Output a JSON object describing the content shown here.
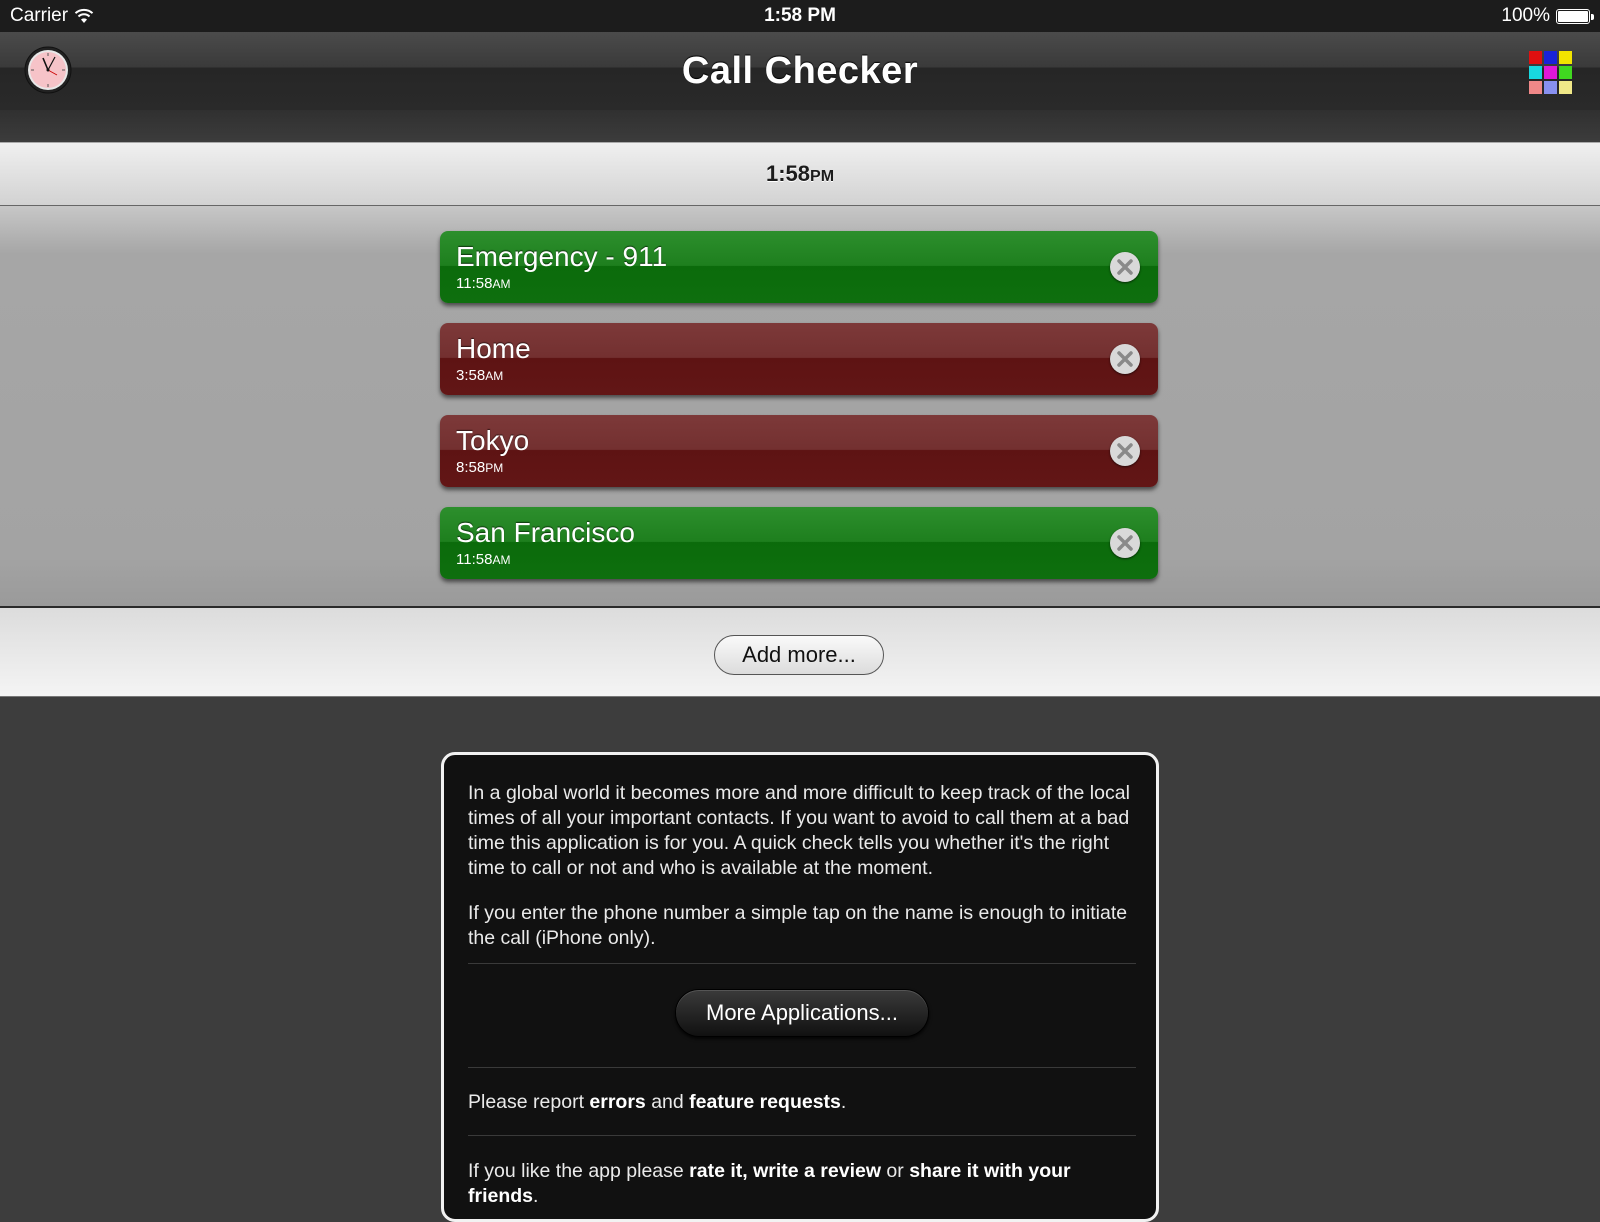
{
  "status_bar": {
    "carrier": "Carrier",
    "time": "1:58 PM",
    "battery": "100%",
    "battery_level": 100
  },
  "nav": {
    "title": "Call Checker",
    "left_icon": "clock-icon",
    "right_icon": "app-grid-icon"
  },
  "current_time": {
    "time": "1:58",
    "ampm": "PM"
  },
  "contacts": [
    {
      "name": "Emergency - 911",
      "time": "11:58",
      "ampm": "AM",
      "status": "green"
    },
    {
      "name": "Home",
      "time": "3:58",
      "ampm": "AM",
      "status": "red"
    },
    {
      "name": "Tokyo",
      "time": "8:58",
      "ampm": "PM",
      "status": "red"
    },
    {
      "name": "San Francisco",
      "time": "11:58",
      "ampm": "AM",
      "status": "green"
    }
  ],
  "add_more_label": "Add more...",
  "info": {
    "p1": "In a global world it becomes more and more difficult to keep track of the local times of all your important contacts. If you want to avoid to call them at a bad time this application is for you. A quick check tells you whether it's the right time to call or not and who is available at the moment.",
    "p2": "If you enter the phone number a simple tap on the name is enough to initiate the call (iPhone only).",
    "more_apps_label": "More Applications...",
    "report": {
      "pre": "Please report ",
      "errors": "errors",
      "and": " and ",
      "features": "feature requests",
      "end": "."
    },
    "rate": {
      "pre": "If you like the app please ",
      "rate": "rate it, write a review",
      "or": " or ",
      "share": "share it with your friends",
      "end": "."
    }
  },
  "colors": {
    "green": "#1e7f1e",
    "red": "#6a1c1c",
    "nav": "#2f2f2f",
    "background": "#3d3d3d"
  }
}
